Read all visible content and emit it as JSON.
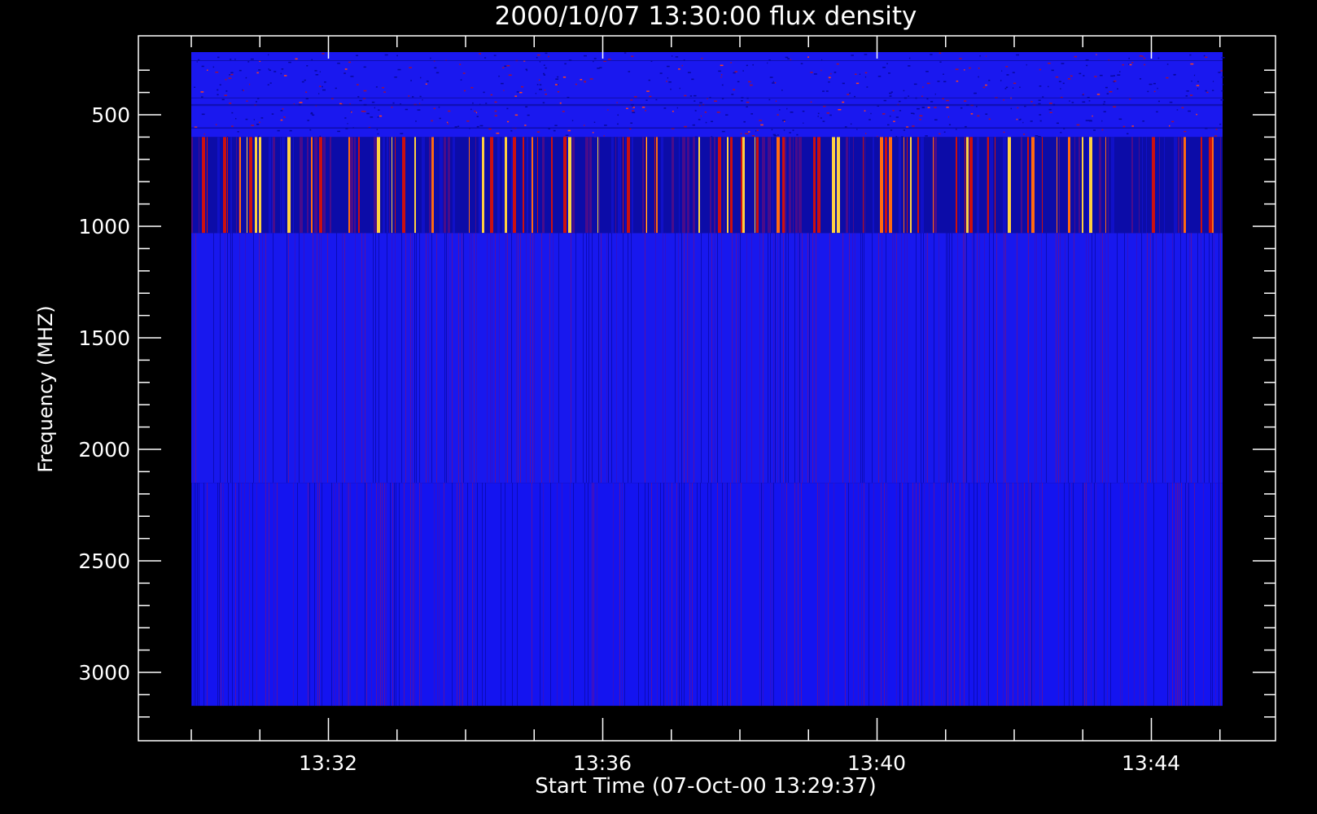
{
  "chart_data": {
    "type": "heatmap",
    "title": "2000/10/07 13:30:00 flux density",
    "xlabel": "Start Time (07-Oct-00 13:29:37)",
    "ylabel": "Frequency (MHZ)",
    "x_axis": {
      "range_minutes": [
        13.517,
        14.917
      ],
      "major_ticks": [
        {
          "value": 13.5333,
          "label": "13:32"
        },
        {
          "value": 13.6,
          "label": "13:36"
        },
        {
          "value": 13.6667,
          "label": "13:40"
        },
        {
          "value": 13.7333,
          "label": "13:44"
        }
      ]
    },
    "y_axis": {
      "range_mhz": [
        200,
        3380
      ],
      "inverted": true,
      "major_ticks": [
        {
          "value": 500,
          "label": "500"
        },
        {
          "value": 1000,
          "label": "1000"
        },
        {
          "value": 1500,
          "label": "1500"
        },
        {
          "value": 2000,
          "label": "2000"
        },
        {
          "value": 2500,
          "label": "2500"
        },
        {
          "value": 3000,
          "label": "3000"
        }
      ],
      "minor_step_mhz": 100
    },
    "time_start": "13:30:00",
    "time_end": "13:45:00",
    "bands": [
      {
        "freq_from": 270,
        "freq_to": 600,
        "base_color": "#1a18ef",
        "style": "speckle"
      },
      {
        "freq_from": 600,
        "freq_to": 1030,
        "base_color": "#0c0ca8",
        "style": "bright-stripes"
      },
      {
        "freq_from": 1030,
        "freq_to": 2150,
        "base_color": "#1818ee",
        "style": "faint-stripes"
      },
      {
        "freq_from": 2150,
        "freq_to": 3150,
        "base_color": "#1414f0",
        "style": "faint-stripes"
      }
    ],
    "colors": {
      "background": "#000000",
      "axes": "#ffffff",
      "low": "#1010f0",
      "mid": "#cc1010",
      "high": "#ffd040"
    },
    "grid": false,
    "legend": "none"
  }
}
